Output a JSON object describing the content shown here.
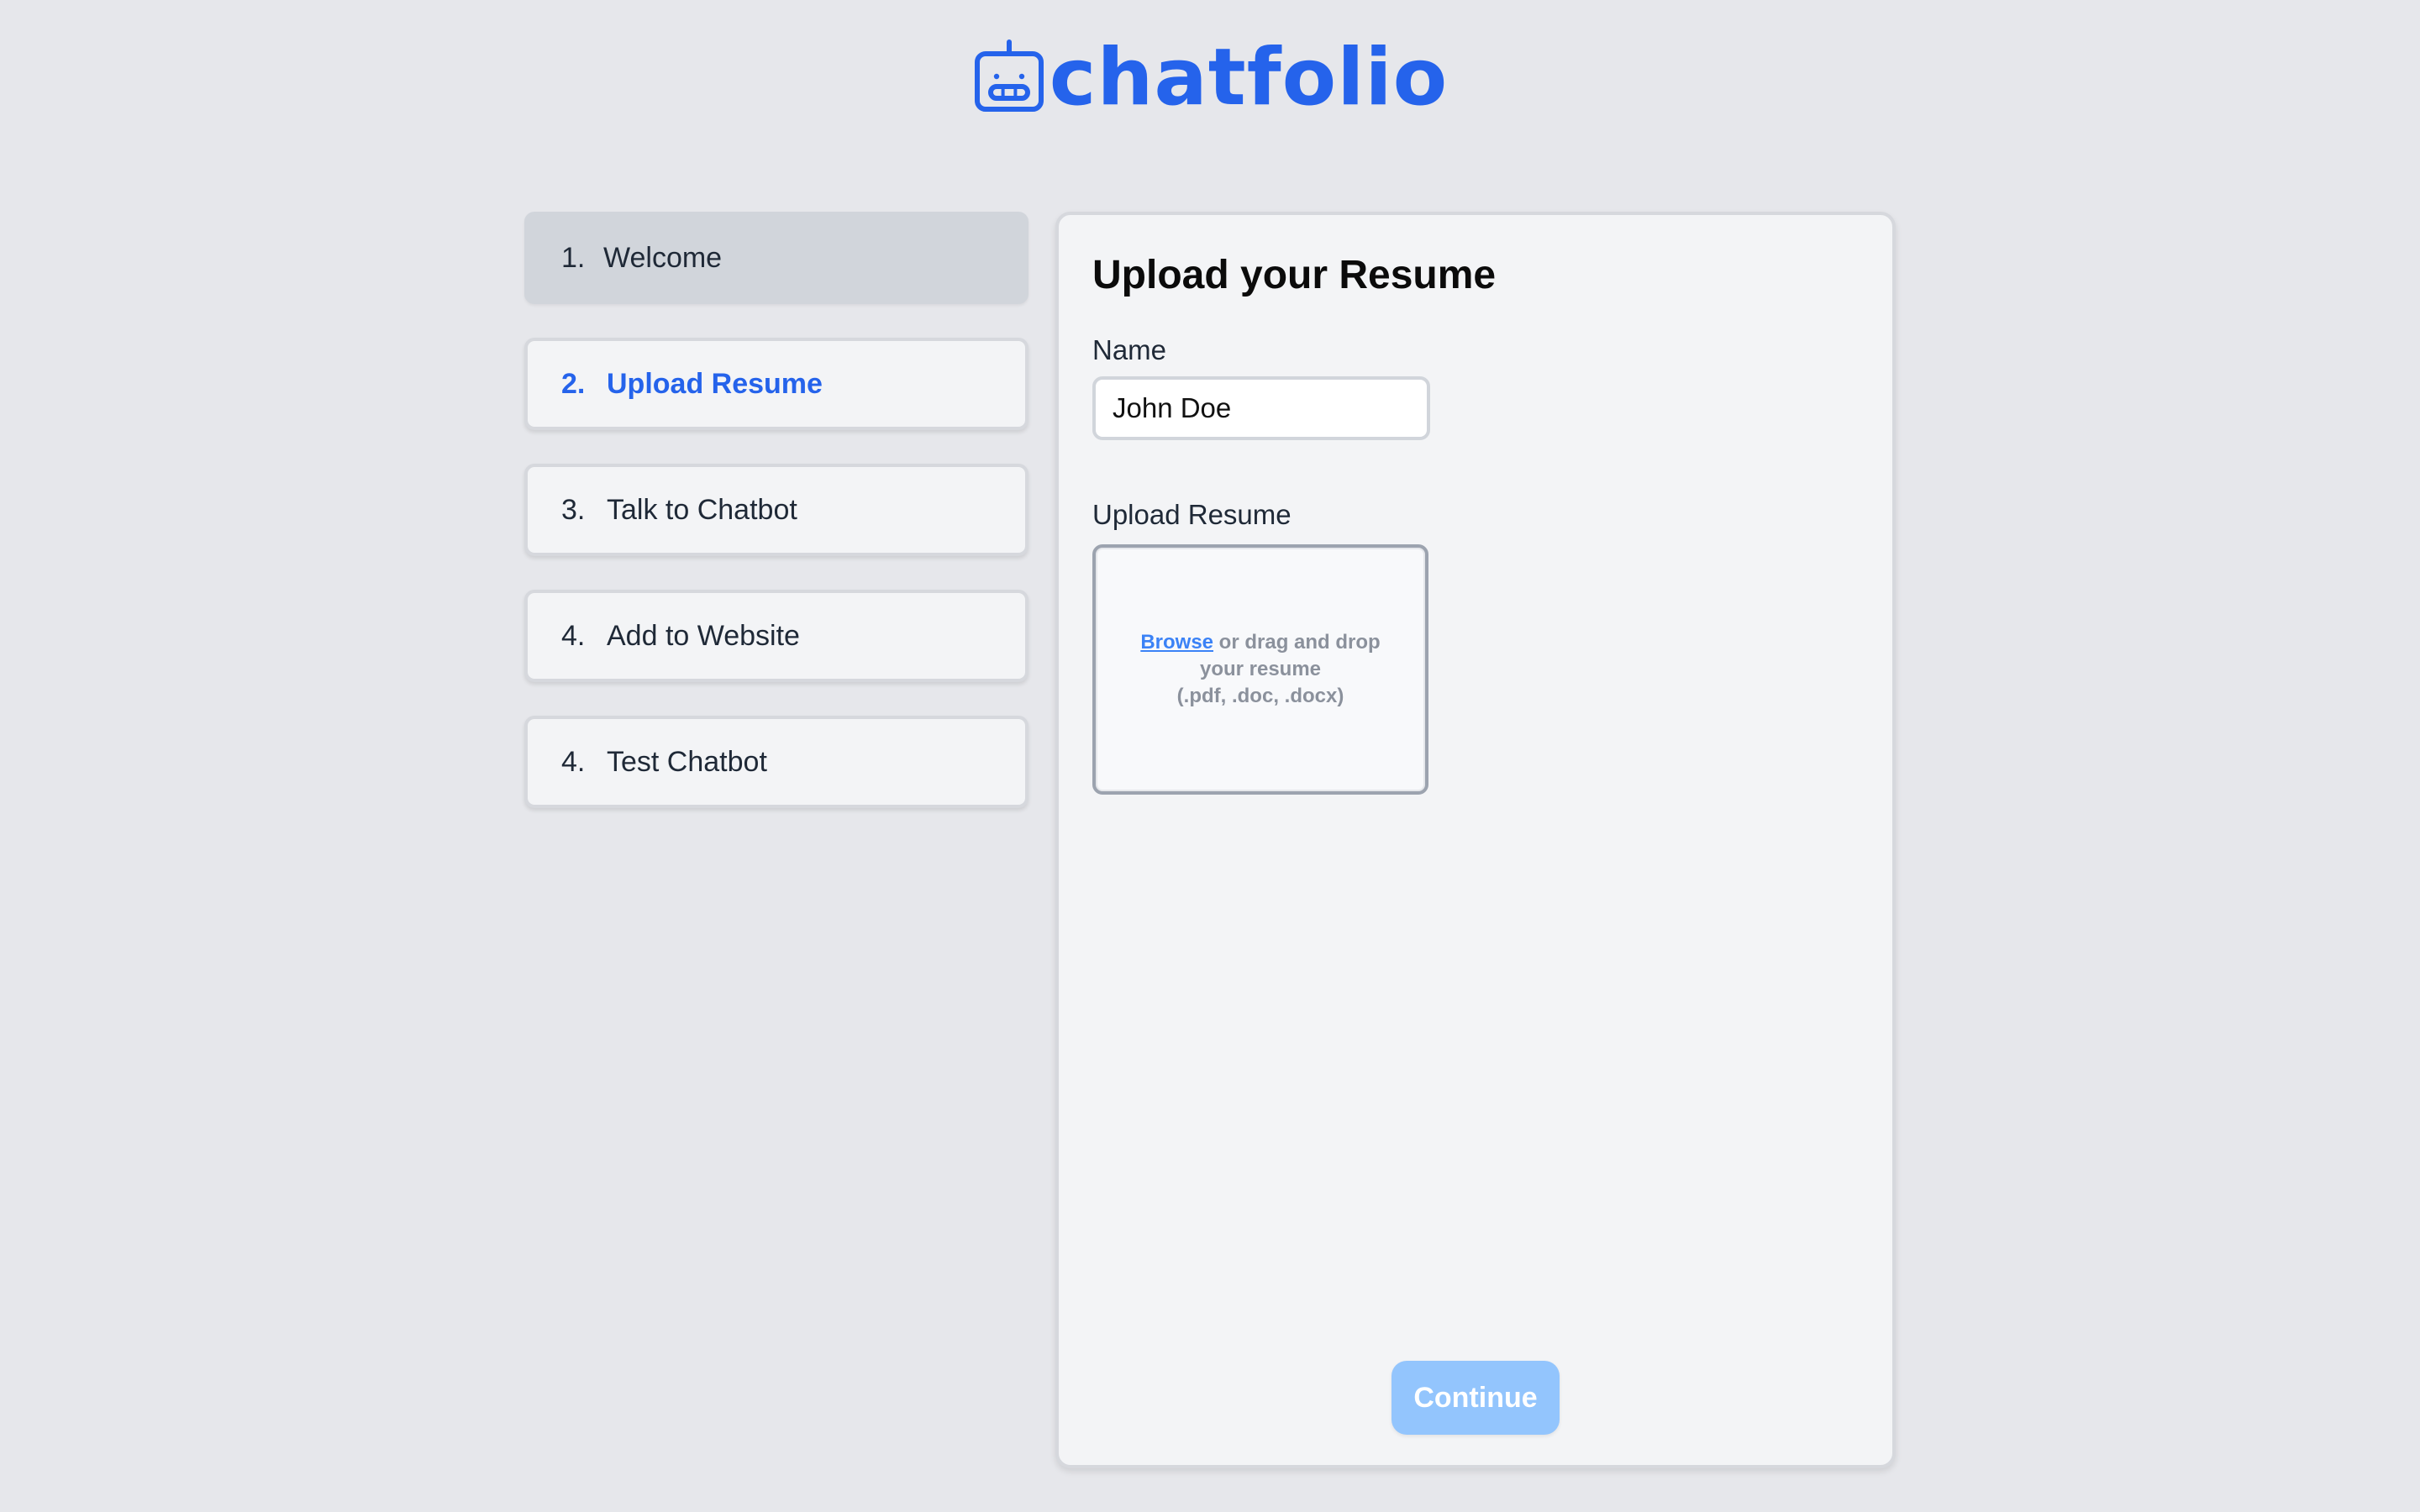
{
  "brand": {
    "name": "chatfolio",
    "icon": "robot-icon",
    "color": "#2563eb"
  },
  "steps": [
    {
      "number": "1.",
      "label": "Welcome",
      "state": "completed"
    },
    {
      "number": "2.",
      "label": "Upload Resume",
      "state": "active"
    },
    {
      "number": "3.",
      "label": "Talk to Chatbot",
      "state": "pending"
    },
    {
      "number": "4.",
      "label": "Add to Website",
      "state": "pending"
    },
    {
      "number": "4.",
      "label": "Test Chatbot",
      "state": "pending"
    }
  ],
  "form": {
    "title": "Upload your Resume",
    "name_label": "Name",
    "name_value": "John Doe",
    "upload_label": "Upload Resume",
    "dropzone": {
      "browse_link": "Browse",
      "text_line1": " or drag and drop",
      "text_line2": "your resume",
      "formats": "(.pdf, .doc, .docx)"
    },
    "continue_label": "Continue",
    "continue_enabled": false
  },
  "colors": {
    "accent": "#2563eb",
    "background": "#e6e7eb",
    "card": "#f3f4f6",
    "continue_disabled": "#93c5fd"
  }
}
